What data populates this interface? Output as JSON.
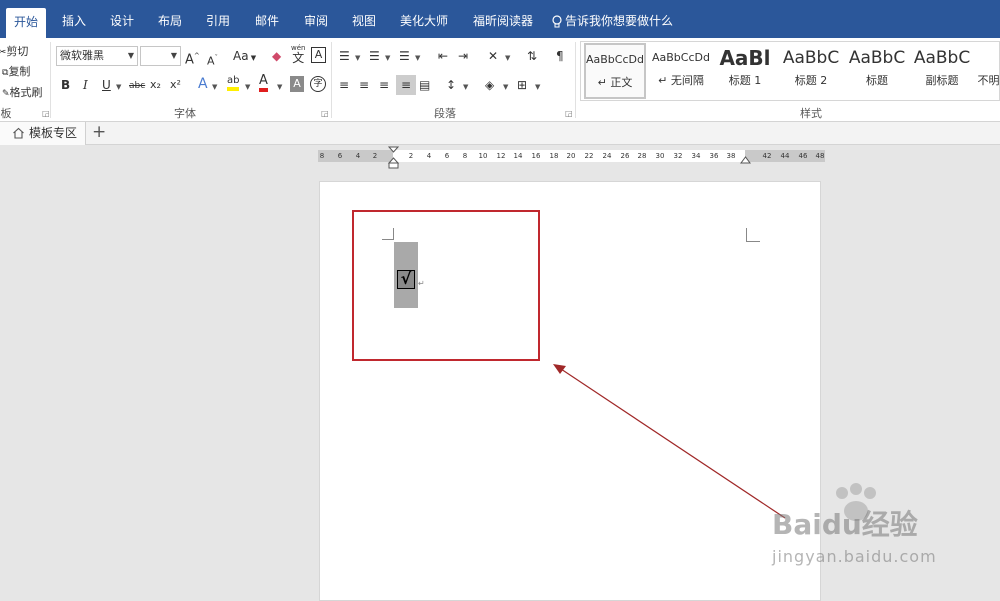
{
  "tabs": [
    "开始",
    "插入",
    "设计",
    "布局",
    "引用",
    "邮件",
    "审阅",
    "视图",
    "美化大师",
    "福昕阅读器"
  ],
  "tell_me": "告诉我你想要做什么",
  "clipboard": {
    "cut": "剪切",
    "copy": "复制",
    "painter": "格式刷",
    "group": "板"
  },
  "font": {
    "name": "微软雅黑",
    "size": "",
    "group": "字体",
    "grow": "A",
    "shrink": "A",
    "case": "Aa",
    "pinyin": "文",
    "pinyin_top": "wén",
    "border": "A",
    "bold": "B",
    "italic": "I",
    "underline": "U",
    "strike": "abc",
    "sub": "x₂",
    "sup": "x²",
    "effects": "A",
    "highlight": "ab",
    "color": "A",
    "shade": "A",
    "enclose": "字"
  },
  "paragraph": {
    "group": "段落"
  },
  "styles": {
    "group": "样式",
    "items": [
      {
        "preview": "AaBbCcDd",
        "name": "↵ 正文"
      },
      {
        "preview": "AaBbCcDd",
        "name": "↵ 无间隔"
      },
      {
        "preview": "AaBl",
        "name": "标题 1"
      },
      {
        "preview": "AaBbC",
        "name": "标题 2"
      },
      {
        "preview": "AaBbC",
        "name": "标题"
      },
      {
        "preview": "AaBbC",
        "name": "副标题"
      },
      {
        "preview": "",
        "name": "不明"
      }
    ]
  },
  "doc_tabs": {
    "template": "模板专区",
    "add": "+"
  },
  "ruler": [
    "8",
    "6",
    "4",
    "2",
    "2",
    "4",
    "6",
    "8",
    "10",
    "12",
    "14",
    "16",
    "18",
    "20",
    "22",
    "24",
    "26",
    "28",
    "30",
    "32",
    "34",
    "36",
    "38",
    "42",
    "44",
    "46",
    "48"
  ],
  "document": {
    "checkbox_symbol": "√",
    "paragraph_mark": "↵"
  },
  "watermark": {
    "brand": "Baidu经验",
    "url": "jingyan.baidu.com"
  },
  "colors": {
    "accent": "#2b579a",
    "highlight_box": "#c0282e",
    "arrow": "#a02828"
  }
}
